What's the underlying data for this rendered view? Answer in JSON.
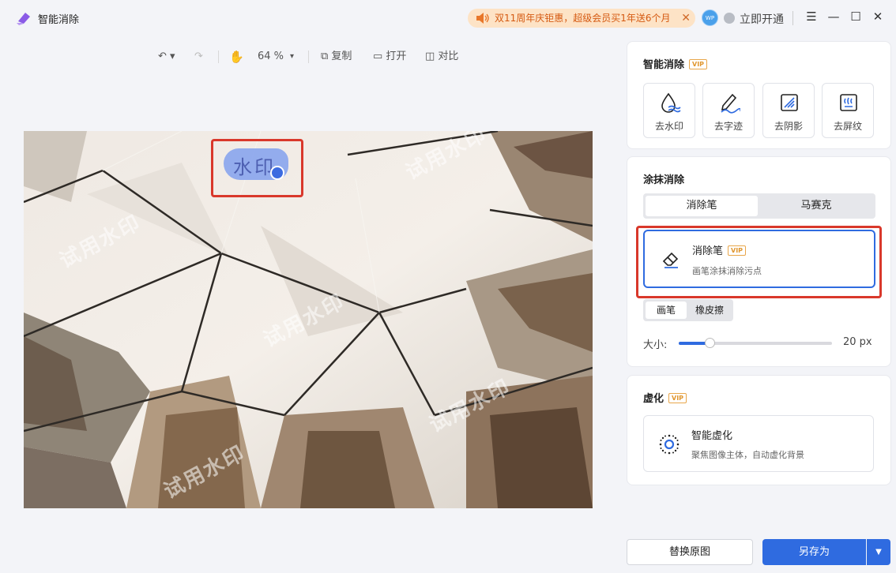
{
  "app": {
    "title": "智能消除"
  },
  "promo": {
    "text": "双11周年庆钜惠，超级会员买1年送6个月"
  },
  "account": {
    "avatar_text": "WP",
    "vip_label": "立即开通"
  },
  "toolbar": {
    "zoom": "64 %",
    "copy": "复制",
    "open": "打开",
    "compare": "对比"
  },
  "canvas": {
    "watermark_text": "试用水印",
    "selected_watermark": "水印"
  },
  "smart_remove": {
    "title": "智能消除",
    "vip": "VIP",
    "tools": [
      {
        "label": "去水印",
        "icon": "watermark-drop-icon"
      },
      {
        "label": "去字迹",
        "icon": "handwriting-icon"
      },
      {
        "label": "去阴影",
        "icon": "shadow-icon"
      },
      {
        "label": "去屏纹",
        "icon": "moire-icon"
      }
    ]
  },
  "brush_remove": {
    "title": "涂抹消除",
    "tabs": [
      "消除笔",
      "马赛克"
    ],
    "eraser": {
      "name": "消除笔",
      "vip": "VIP",
      "desc": "画笔涂抹消除污点"
    },
    "modes": [
      "画笔",
      "橡皮擦"
    ],
    "size_label": "大小:",
    "size_value": "20 px",
    "size_level": 0.2
  },
  "blur": {
    "title": "虚化",
    "vip": "VIP",
    "card": {
      "name": "智能虚化",
      "desc": "聚焦图像主体，自动虚化背景"
    }
  },
  "actions": {
    "replace": "替换原图",
    "save_as": "另存为"
  },
  "colors": {
    "accent": "#2f6be0",
    "highlight": "#d9382b",
    "promo": "#d55a12"
  }
}
